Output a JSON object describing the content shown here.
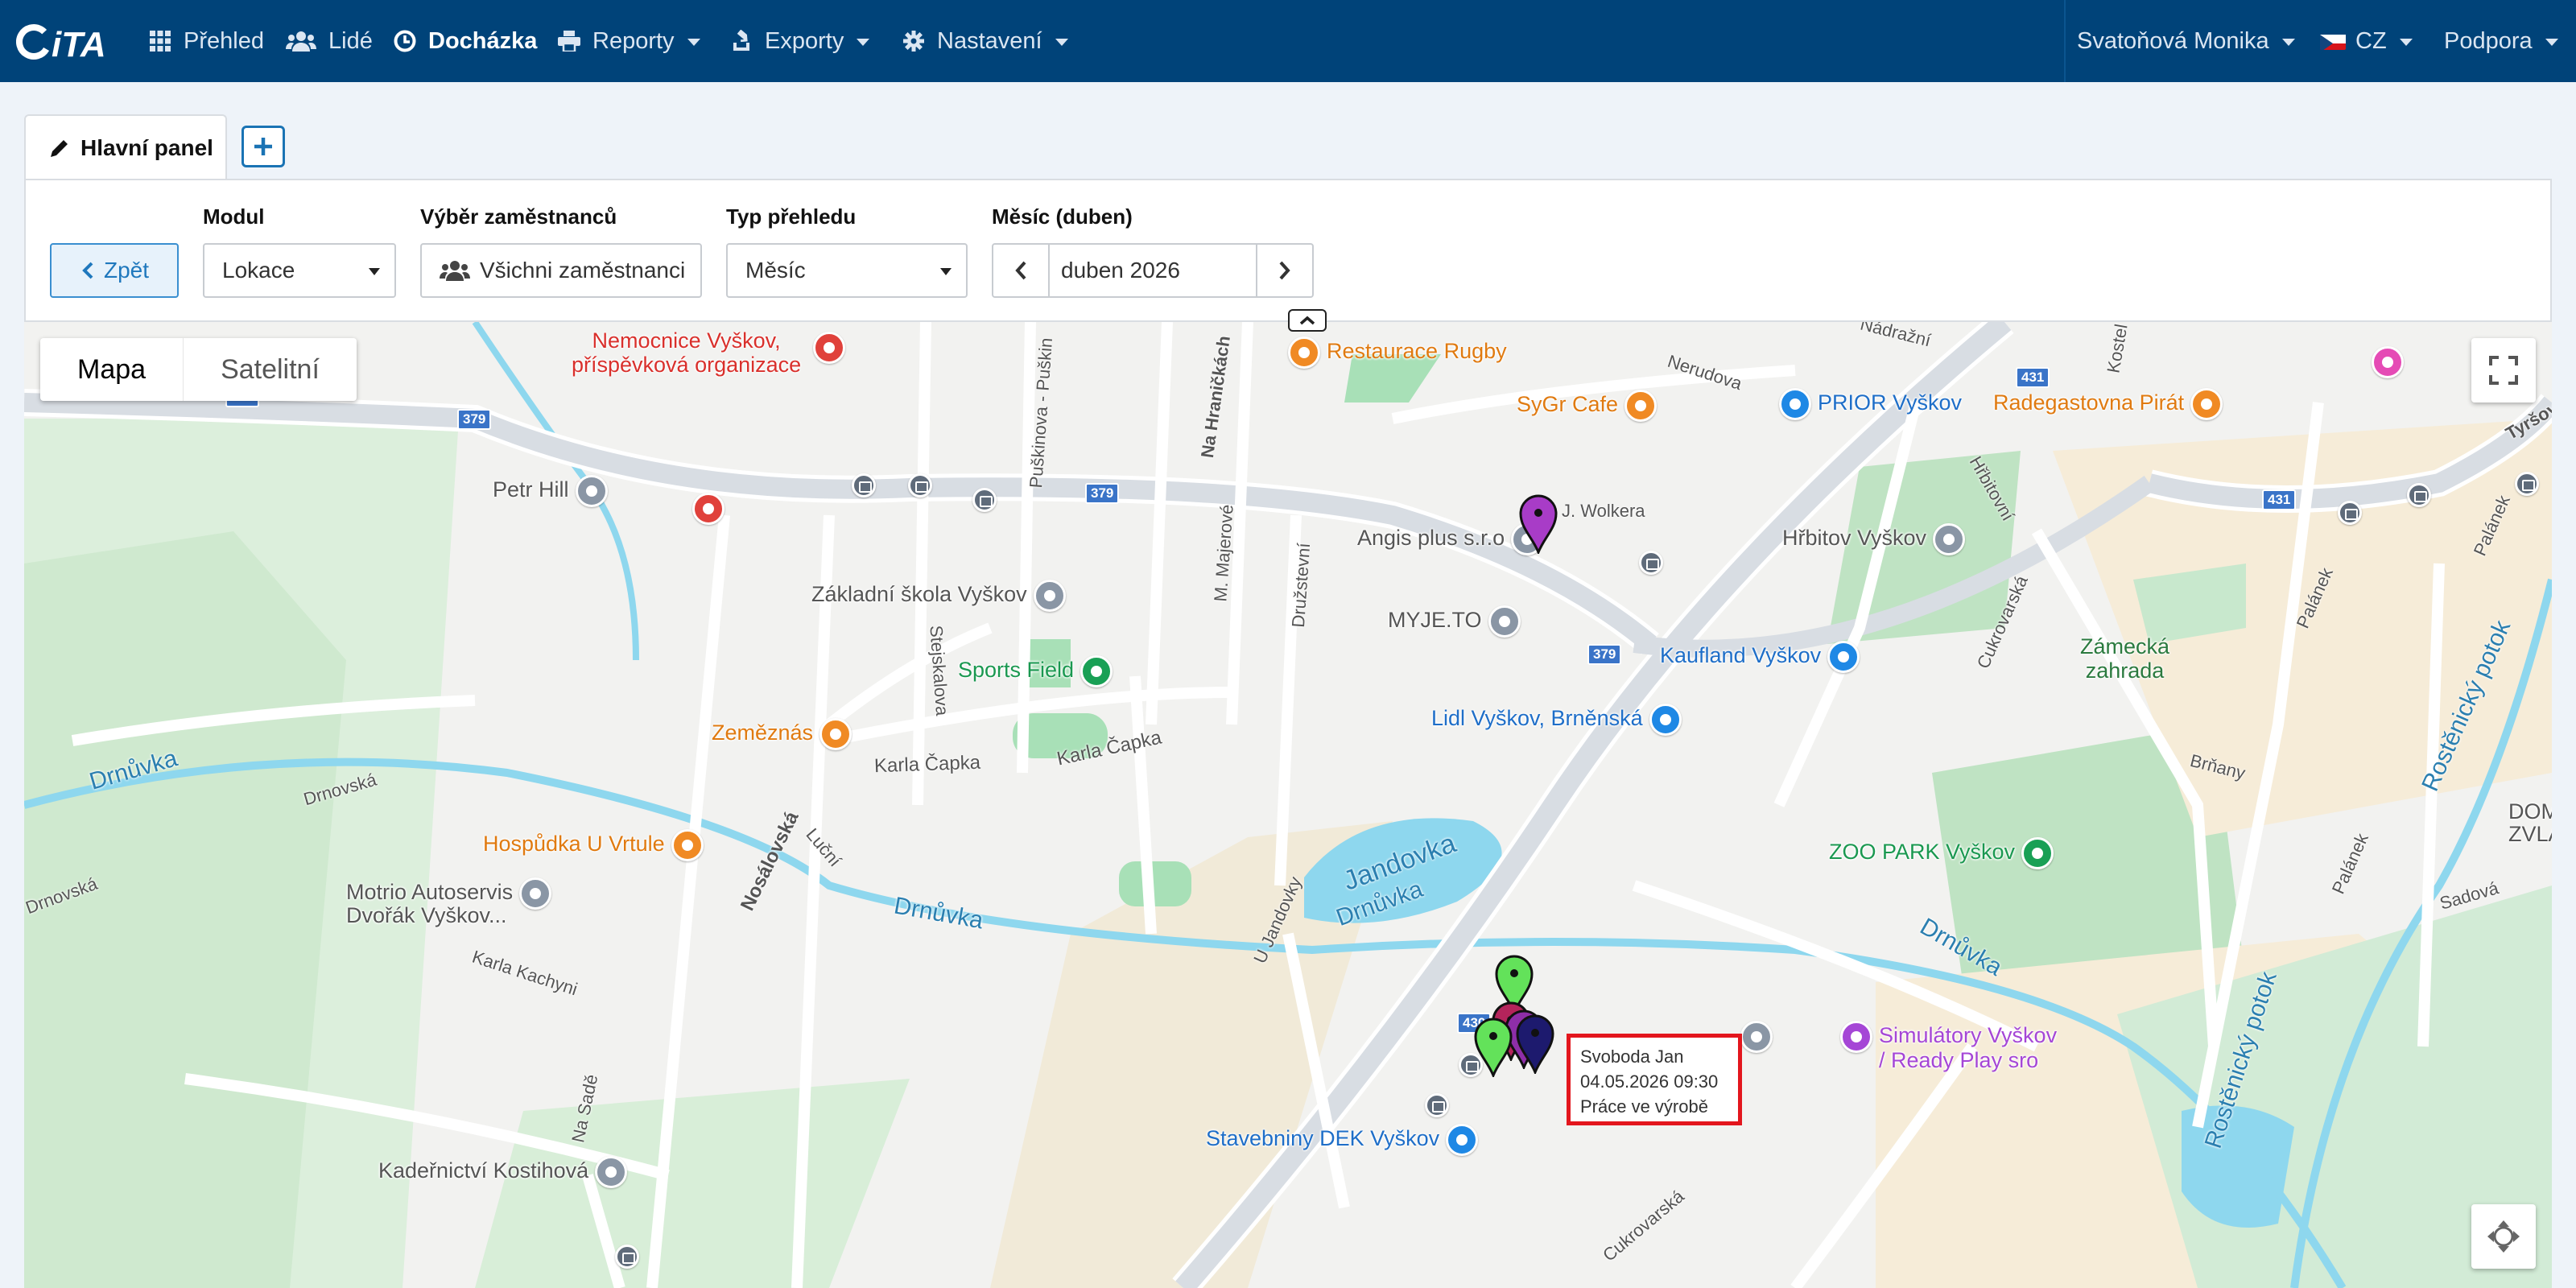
{
  "brand": {
    "logo_text": "CiTA"
  },
  "nav": {
    "items": [
      {
        "label": "Přehled",
        "icon": "grid-icon"
      },
      {
        "label": "Lidé",
        "icon": "users-icon"
      },
      {
        "label": "Docházka",
        "icon": "clock-icon",
        "active": true
      },
      {
        "label": "Reporty",
        "icon": "printer-icon"
      },
      {
        "label": "Exporty",
        "icon": "export-icon"
      },
      {
        "label": "Nastavení",
        "icon": "gear-icon"
      }
    ],
    "user": "Svatoňová Monika",
    "language": "CZ",
    "support": "Podpora"
  },
  "tabs": {
    "main_label": "Hlavní panel",
    "add_label": "+"
  },
  "filters": {
    "back_label": "Zpět",
    "module_label": "Modul",
    "module_value": "Lokace",
    "employees_label": "Výběr zaměstnanců",
    "employees_value": "Všichni zaměstnanci",
    "view_type_label": "Typ přehledu",
    "view_type_value": "Měsíc",
    "month_label": "Měsíc (duben)",
    "month_value": "duben 2026"
  },
  "map": {
    "type_map": "Mapa",
    "type_satellite": "Satelitní",
    "pois": {
      "hospital": "Nemocnice Vyškov,",
      "hospital2": "příspěvková organizace",
      "restaurace_rugby": "Restaurace Rugby",
      "sygr": "SyGr Cafe",
      "prior": "PRIOR Vyškov",
      "radegast": "Radegastovna Pirát",
      "petr_hill": "Petr Hill",
      "angis": "Angis plus s.r.o",
      "zakladni": "Základní škola Vyškov",
      "myje": "MYJE.TO",
      "hrbitov": "Hřbitov Vyškov",
      "sports": "Sports Field",
      "kaufland": "Kaufland Vyškov",
      "zamecka": "Zámecká",
      "zamecka2": "zahrada",
      "lidl": "Lidl Vyškov, Brněnská",
      "zemeznas": "Zeměznás",
      "hospudka": "Hospůdka U Vrtule",
      "zoo": "ZOO PARK Vyškov",
      "motrio": "Motrio Autoservis",
      "motrio2": "Dvořák Vyškov...",
      "simulatory": "Simulátory Vyškov",
      "simulatory2": "/ Ready Play sro",
      "dek": "Stavebniny DEK Vyškov",
      "kadernictvi": "Kadeřnictví Kostihová",
      "dom": "DOM",
      "zvlas": "ZVLÁŠ"
    },
    "roads": {
      "nadrazni": "Nádražní",
      "nerudova": "Nerudova",
      "kostelni": "Kostel",
      "tyrsova": "Tyršov",
      "puskinova": "Puškinova - Puškin",
      "na_hranickach": "Na Hraničkách",
      "j_wolkera": "J. Wolkera",
      "hrbitovni": "Hřbitovní",
      "majerove": "M. Majerové",
      "druzstevni": "Družstevní",
      "stejskalova": "Stejskalova",
      "cukrovarska": "Cukrovarská",
      "palanek": "Palánek",
      "karla_capka": "Karla Čapka",
      "drnovska": "Drnovská",
      "nosalovska": "Nosálovská",
      "lucni": "Luční",
      "u_jandovky": "U Jandovky",
      "brhany": "Brňany",
      "sadova": "Sadová",
      "karla_kachyni": "Karla Kachyni",
      "na_sade": "Na Sadě",
      "rostenicky": "Rostěnický potok",
      "drnuvka": "Drnůvka",
      "jandovka": "Jandovka",
      "r379": "379",
      "r430": "430",
      "r431": "431"
    },
    "tooltip": {
      "name": "Svoboda Jan",
      "datetime": "04.05.2026 09:30",
      "activity": "Práce ve výrobě"
    }
  },
  "colors": {
    "nav_bg": "#004379",
    "accent": "#1a73b4",
    "highlight": "#e3161d"
  }
}
